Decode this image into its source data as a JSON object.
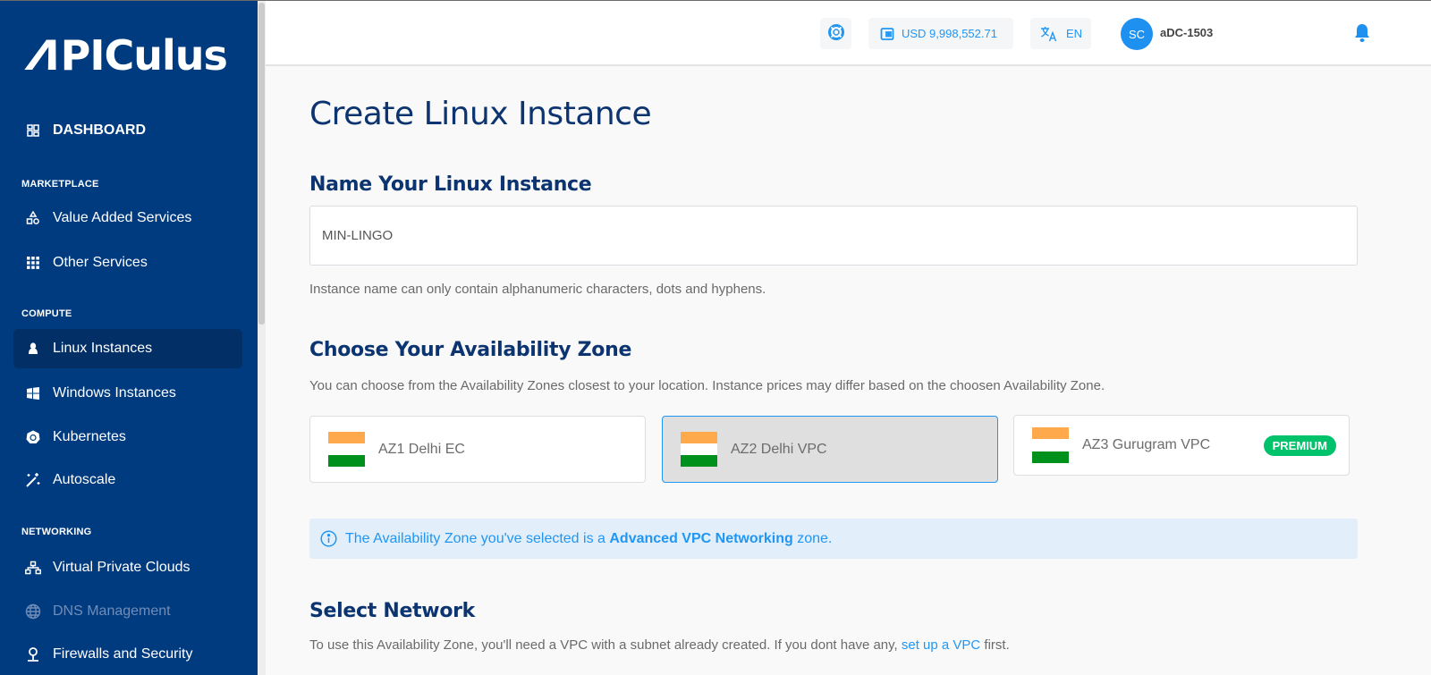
{
  "brand": {
    "logo_text_a": "Λ",
    "logo_text_rest": "PICulus"
  },
  "sidebar": {
    "dashboard": "DASHBOARD",
    "sections": [
      {
        "label": "MARKETPLACE",
        "items": [
          {
            "label": "Value Added Services",
            "icon": "shapes-icon"
          },
          {
            "label": "Other Services",
            "icon": "grid-icon"
          }
        ]
      },
      {
        "label": "COMPUTE",
        "items": [
          {
            "label": "Linux Instances",
            "icon": "linux-icon",
            "active": true
          },
          {
            "label": "Windows Instances",
            "icon": "windows-icon"
          },
          {
            "label": "Kubernetes",
            "icon": "kubernetes-icon"
          },
          {
            "label": "Autoscale",
            "icon": "magic-wand-icon"
          }
        ]
      },
      {
        "label": "NETWORKING",
        "items": [
          {
            "label": "Virtual Private Clouds",
            "icon": "network-icon"
          },
          {
            "label": "DNS Management",
            "icon": "globe-icon",
            "disabled": true
          },
          {
            "label": "Firewalls and Security",
            "icon": "shield-pin-icon"
          }
        ]
      }
    ]
  },
  "header": {
    "balance": "USD 9,998,552.71",
    "language": "EN",
    "avatar_initials": "SC",
    "username": "aDC-1503"
  },
  "main": {
    "page_title": "Create Linux Instance",
    "name_section": {
      "title": "Name Your Linux Instance",
      "value": "MIN-LINGO",
      "help": "Instance name can only contain alphanumeric characters, dots and hyphens."
    },
    "az_section": {
      "title": "Choose Your Availability Zone",
      "help": "You can choose from the Availability Zones closest to your location. Instance prices may differ based on the choosen Availability Zone.",
      "zones": [
        {
          "name": "AZ1 Delhi EC",
          "selected": false
        },
        {
          "name": "AZ2 Delhi VPC",
          "selected": true
        },
        {
          "name": "AZ3 Gurugram VPC",
          "selected": false,
          "badge": "PREMIUM"
        }
      ],
      "info_pre": "The Availability Zone you've selected is a ",
      "info_bold": "Advanced VPC Networking",
      "info_post": " zone."
    },
    "network_section": {
      "title": "Select Network",
      "help_pre": "To use this Availability Zone, you'll need a VPC with a subnet already created. If you dont have any, ",
      "help_link": "set up a VPC",
      "help_post": " first."
    }
  },
  "colors": {
    "sidebar": "#003b80",
    "accent": "#2196f3",
    "premium": "#00c26b",
    "title": "#0c3470"
  }
}
